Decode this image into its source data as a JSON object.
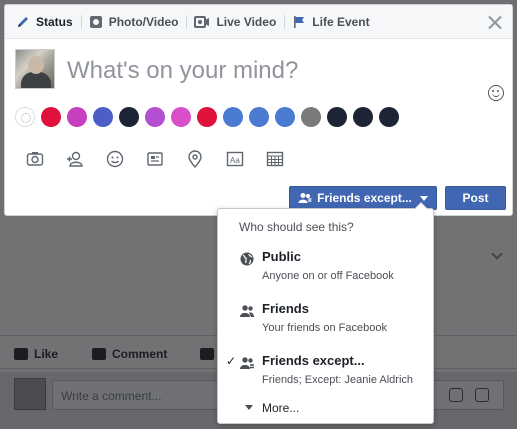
{
  "tabs": [
    {
      "label": "Status",
      "icon": "pencil-icon"
    },
    {
      "label": "Photo/Video",
      "icon": "camera-icon"
    },
    {
      "label": "Live Video",
      "icon": "video-icon"
    },
    {
      "label": "Life Event",
      "icon": "flag-icon"
    }
  ],
  "composer": {
    "placeholder": "What's on your mind?",
    "swatch_colors": [
      "#ffffff",
      "#e0123c",
      "#c63fbd",
      "#4d5ec9",
      "#1c2435",
      "#b34fd0",
      "#d94fc9",
      "#e0123c",
      "#4a7bd1",
      "#4a7bd1",
      "#4a7bd1",
      "#7a7a7a",
      "#1c2435",
      "#1c2435",
      "#1c2435"
    ],
    "tool_icons": [
      "photo-icon",
      "tag-friends-icon",
      "feeling-icon",
      "gif-sticker-icon",
      "location-icon",
      "text-style-icon",
      "calendar-icon"
    ]
  },
  "privacy_button": {
    "label": "Friends except..."
  },
  "post_button": {
    "label": "Post"
  },
  "dropdown": {
    "header": "Who should see this?",
    "options": [
      {
        "title": "Public",
        "subtitle": "Anyone on or off Facebook",
        "icon": "globe-icon",
        "selected": false
      },
      {
        "title": "Friends",
        "subtitle": "Your friends on Facebook",
        "icon": "friends-icon",
        "selected": false
      },
      {
        "title": "Friends except...",
        "subtitle": "Friends; Except: Jeanie Aldrich",
        "icon": "friends-except-icon",
        "selected": true
      }
    ],
    "check_glyph": "✓",
    "more_label": "More..."
  },
  "background_feed": {
    "like_label": "Like",
    "comment_label": "Comment",
    "comment_placeholder": "Write a comment..."
  },
  "colors": {
    "accent": "#4267b2",
    "overlay": "#6d6f73"
  }
}
